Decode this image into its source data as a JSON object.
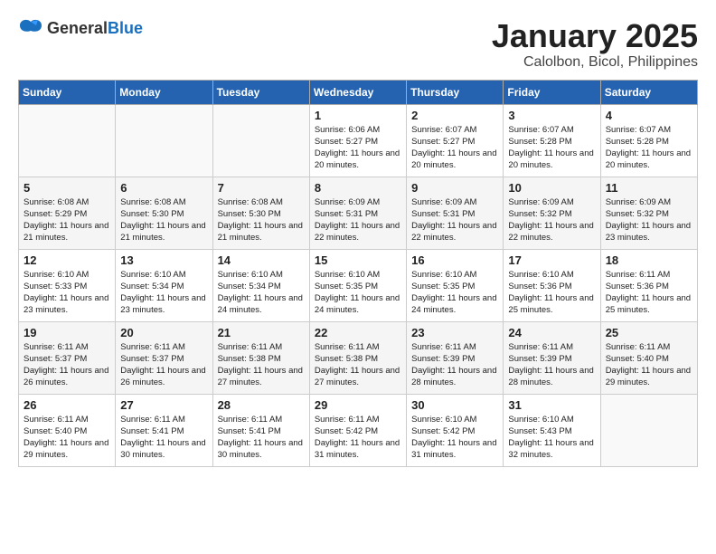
{
  "header": {
    "logo_general": "General",
    "logo_blue": "Blue",
    "title": "January 2025",
    "subtitle": "Calolbon, Bicol, Philippines"
  },
  "weekdays": [
    "Sunday",
    "Monday",
    "Tuesday",
    "Wednesday",
    "Thursday",
    "Friday",
    "Saturday"
  ],
  "weeks": [
    [
      {
        "day": "",
        "sunrise": "",
        "sunset": "",
        "daylight": ""
      },
      {
        "day": "",
        "sunrise": "",
        "sunset": "",
        "daylight": ""
      },
      {
        "day": "",
        "sunrise": "",
        "sunset": "",
        "daylight": ""
      },
      {
        "day": "1",
        "sunrise": "Sunrise: 6:06 AM",
        "sunset": "Sunset: 5:27 PM",
        "daylight": "Daylight: 11 hours and 20 minutes."
      },
      {
        "day": "2",
        "sunrise": "Sunrise: 6:07 AM",
        "sunset": "Sunset: 5:27 PM",
        "daylight": "Daylight: 11 hours and 20 minutes."
      },
      {
        "day": "3",
        "sunrise": "Sunrise: 6:07 AM",
        "sunset": "Sunset: 5:28 PM",
        "daylight": "Daylight: 11 hours and 20 minutes."
      },
      {
        "day": "4",
        "sunrise": "Sunrise: 6:07 AM",
        "sunset": "Sunset: 5:28 PM",
        "daylight": "Daylight: 11 hours and 20 minutes."
      }
    ],
    [
      {
        "day": "5",
        "sunrise": "Sunrise: 6:08 AM",
        "sunset": "Sunset: 5:29 PM",
        "daylight": "Daylight: 11 hours and 21 minutes."
      },
      {
        "day": "6",
        "sunrise": "Sunrise: 6:08 AM",
        "sunset": "Sunset: 5:30 PM",
        "daylight": "Daylight: 11 hours and 21 minutes."
      },
      {
        "day": "7",
        "sunrise": "Sunrise: 6:08 AM",
        "sunset": "Sunset: 5:30 PM",
        "daylight": "Daylight: 11 hours and 21 minutes."
      },
      {
        "day": "8",
        "sunrise": "Sunrise: 6:09 AM",
        "sunset": "Sunset: 5:31 PM",
        "daylight": "Daylight: 11 hours and 22 minutes."
      },
      {
        "day": "9",
        "sunrise": "Sunrise: 6:09 AM",
        "sunset": "Sunset: 5:31 PM",
        "daylight": "Daylight: 11 hours and 22 minutes."
      },
      {
        "day": "10",
        "sunrise": "Sunrise: 6:09 AM",
        "sunset": "Sunset: 5:32 PM",
        "daylight": "Daylight: 11 hours and 22 minutes."
      },
      {
        "day": "11",
        "sunrise": "Sunrise: 6:09 AM",
        "sunset": "Sunset: 5:32 PM",
        "daylight": "Daylight: 11 hours and 23 minutes."
      }
    ],
    [
      {
        "day": "12",
        "sunrise": "Sunrise: 6:10 AM",
        "sunset": "Sunset: 5:33 PM",
        "daylight": "Daylight: 11 hours and 23 minutes."
      },
      {
        "day": "13",
        "sunrise": "Sunrise: 6:10 AM",
        "sunset": "Sunset: 5:34 PM",
        "daylight": "Daylight: 11 hours and 23 minutes."
      },
      {
        "day": "14",
        "sunrise": "Sunrise: 6:10 AM",
        "sunset": "Sunset: 5:34 PM",
        "daylight": "Daylight: 11 hours and 24 minutes."
      },
      {
        "day": "15",
        "sunrise": "Sunrise: 6:10 AM",
        "sunset": "Sunset: 5:35 PM",
        "daylight": "Daylight: 11 hours and 24 minutes."
      },
      {
        "day": "16",
        "sunrise": "Sunrise: 6:10 AM",
        "sunset": "Sunset: 5:35 PM",
        "daylight": "Daylight: 11 hours and 24 minutes."
      },
      {
        "day": "17",
        "sunrise": "Sunrise: 6:10 AM",
        "sunset": "Sunset: 5:36 PM",
        "daylight": "Daylight: 11 hours and 25 minutes."
      },
      {
        "day": "18",
        "sunrise": "Sunrise: 6:11 AM",
        "sunset": "Sunset: 5:36 PM",
        "daylight": "Daylight: 11 hours and 25 minutes."
      }
    ],
    [
      {
        "day": "19",
        "sunrise": "Sunrise: 6:11 AM",
        "sunset": "Sunset: 5:37 PM",
        "daylight": "Daylight: 11 hours and 26 minutes."
      },
      {
        "day": "20",
        "sunrise": "Sunrise: 6:11 AM",
        "sunset": "Sunset: 5:37 PM",
        "daylight": "Daylight: 11 hours and 26 minutes."
      },
      {
        "day": "21",
        "sunrise": "Sunrise: 6:11 AM",
        "sunset": "Sunset: 5:38 PM",
        "daylight": "Daylight: 11 hours and 27 minutes."
      },
      {
        "day": "22",
        "sunrise": "Sunrise: 6:11 AM",
        "sunset": "Sunset: 5:38 PM",
        "daylight": "Daylight: 11 hours and 27 minutes."
      },
      {
        "day": "23",
        "sunrise": "Sunrise: 6:11 AM",
        "sunset": "Sunset: 5:39 PM",
        "daylight": "Daylight: 11 hours and 28 minutes."
      },
      {
        "day": "24",
        "sunrise": "Sunrise: 6:11 AM",
        "sunset": "Sunset: 5:39 PM",
        "daylight": "Daylight: 11 hours and 28 minutes."
      },
      {
        "day": "25",
        "sunrise": "Sunrise: 6:11 AM",
        "sunset": "Sunset: 5:40 PM",
        "daylight": "Daylight: 11 hours and 29 minutes."
      }
    ],
    [
      {
        "day": "26",
        "sunrise": "Sunrise: 6:11 AM",
        "sunset": "Sunset: 5:40 PM",
        "daylight": "Daylight: 11 hours and 29 minutes."
      },
      {
        "day": "27",
        "sunrise": "Sunrise: 6:11 AM",
        "sunset": "Sunset: 5:41 PM",
        "daylight": "Daylight: 11 hours and 30 minutes."
      },
      {
        "day": "28",
        "sunrise": "Sunrise: 6:11 AM",
        "sunset": "Sunset: 5:41 PM",
        "daylight": "Daylight: 11 hours and 30 minutes."
      },
      {
        "day": "29",
        "sunrise": "Sunrise: 6:11 AM",
        "sunset": "Sunset: 5:42 PM",
        "daylight": "Daylight: 11 hours and 31 minutes."
      },
      {
        "day": "30",
        "sunrise": "Sunrise: 6:10 AM",
        "sunset": "Sunset: 5:42 PM",
        "daylight": "Daylight: 11 hours and 31 minutes."
      },
      {
        "day": "31",
        "sunrise": "Sunrise: 6:10 AM",
        "sunset": "Sunset: 5:43 PM",
        "daylight": "Daylight: 11 hours and 32 minutes."
      },
      {
        "day": "",
        "sunrise": "",
        "sunset": "",
        "daylight": ""
      }
    ]
  ]
}
